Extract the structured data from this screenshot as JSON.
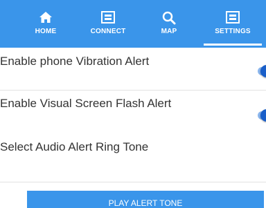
{
  "tabs": [
    {
      "label": "HOME",
      "icon": "home-icon"
    },
    {
      "label": "CONNECT",
      "icon": "connect-icon"
    },
    {
      "label": "MAP",
      "icon": "search-icon"
    },
    {
      "label": "SETTINGS",
      "icon": "settings-icon"
    }
  ],
  "active_tab": "SETTINGS",
  "settings": {
    "vibration_label": "Enable phone Vibration Alert",
    "vibration_enabled": true,
    "flash_label": "Enable Visual Screen Flash Alert",
    "flash_enabled": true,
    "ringtone_label": "Select Audio Alert Ring Tone"
  },
  "play_button_label": "PLAY ALERT TONE",
  "colors": {
    "header": "#3a95ea",
    "toggle_on": "#1a5fc9"
  }
}
